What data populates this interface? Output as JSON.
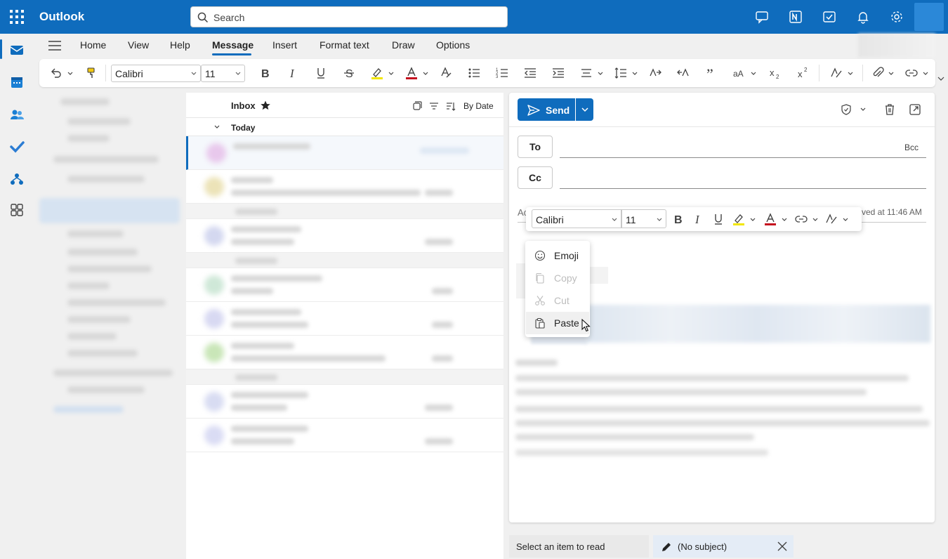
{
  "app": {
    "title": "Outlook"
  },
  "search": {
    "placeholder": "Search"
  },
  "colors": {
    "brand": "#0f6cbd",
    "highlight": "#f2e600",
    "font_color": "#c50f1f"
  },
  "ribbon": {
    "tabs": [
      {
        "label": "Home"
      },
      {
        "label": "View"
      },
      {
        "label": "Help"
      },
      {
        "label": "Message"
      },
      {
        "label": "Insert"
      },
      {
        "label": "Format text"
      },
      {
        "label": "Draw"
      },
      {
        "label": "Options"
      }
    ],
    "active_tab": "Message",
    "font_name": "Calibri",
    "font_size": "11"
  },
  "message_list": {
    "folder": "Inbox",
    "sort": "By Date",
    "group": "Today"
  },
  "compose": {
    "send_label": "Send",
    "to_label": "To",
    "cc_label": "Cc",
    "bcc_label": "Bcc",
    "subject_fragment": "Ac",
    "saved_text": "ved at 11:46 AM"
  },
  "float_toolbar": {
    "font_name": "Calibri",
    "font_size": "11"
  },
  "context_menu": {
    "items": [
      {
        "label": "Emoji",
        "icon": "emoji-icon",
        "enabled": true
      },
      {
        "label": "Copy",
        "icon": "copy-icon",
        "enabled": false
      },
      {
        "label": "Cut",
        "icon": "cut-icon",
        "enabled": false
      },
      {
        "label": "Paste",
        "icon": "paste-icon",
        "enabled": true
      }
    ]
  },
  "bottom_bar": {
    "reading_tab": "Select an item to read",
    "draft_tab": "(No subject)"
  }
}
